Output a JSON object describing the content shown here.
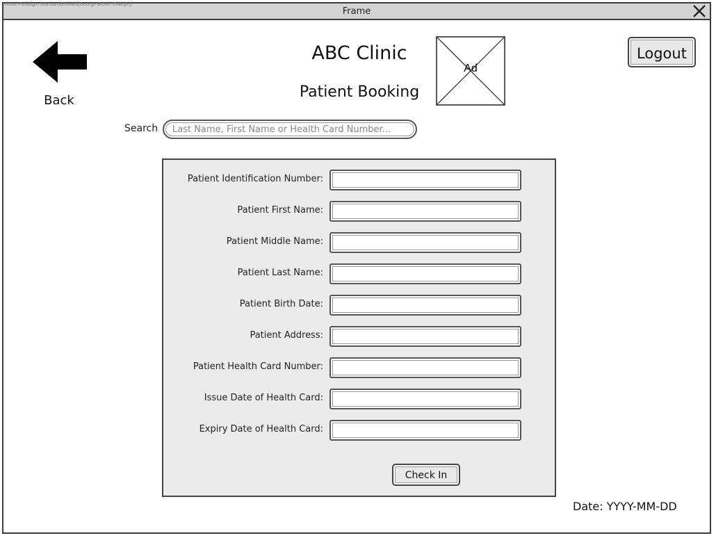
{
  "window": {
    "title": "Frame",
    "watermark": "Visual Paradigm Standard(Edward(George Brown College))",
    "close_icon": "close-x-icon"
  },
  "header": {
    "back_label": "Back",
    "back_icon": "arrow-left-icon",
    "clinic_name": "ABC Clinic",
    "page_title": "Patient Booking",
    "ad_label": "Ad",
    "logout_label": "Logout"
  },
  "search": {
    "label": "Search",
    "placeholder": "Last Name, First Name or Health Card Number..."
  },
  "form": {
    "fields": [
      {
        "label": "Patient Identification Number:",
        "value": ""
      },
      {
        "label": "Patient First Name:",
        "value": ""
      },
      {
        "label": "Patient Middle Name:",
        "value": ""
      },
      {
        "label": "Patient Last Name:",
        "value": ""
      },
      {
        "label": "Patient Birth Date:",
        "value": ""
      },
      {
        "label": "Patient Address:",
        "value": ""
      },
      {
        "label": "Patient Health Card Number:",
        "value": ""
      },
      {
        "label": "Issue Date of Health Card:",
        "value": ""
      },
      {
        "label": "Expiry Date of Health Card:",
        "value": ""
      }
    ],
    "submit_label": "Check In"
  },
  "footer": {
    "date_text": "Date: YYYY-MM-DD"
  },
  "colors": {
    "titlebar": "#d4d4d4",
    "panel": "#ebebeb",
    "border": "#444444"
  }
}
